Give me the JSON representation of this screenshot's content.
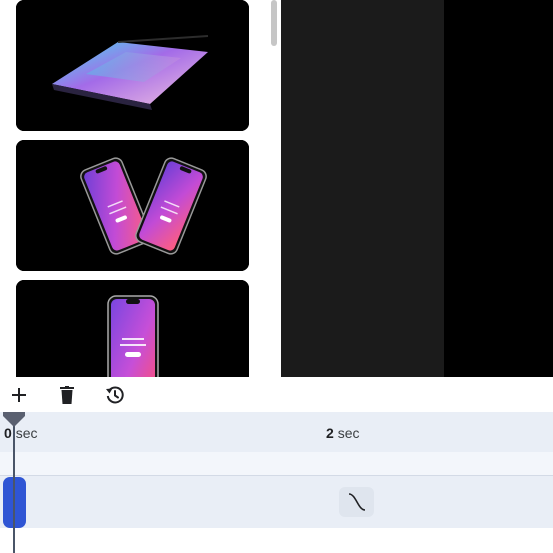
{
  "thumbnails": [
    {
      "name": "laptop-mockup"
    },
    {
      "name": "two-phones-mockup"
    },
    {
      "name": "single-phone-mockup"
    }
  ],
  "toolbar": {
    "add_icon": "plus-icon",
    "delete_icon": "trash-icon",
    "history_icon": "history-icon"
  },
  "timeline": {
    "ruler": [
      {
        "num": "0",
        "unit": "sec"
      },
      {
        "num": "2",
        "unit": "sec"
      }
    ],
    "transition_icon": "ease-curve-icon"
  },
  "colors": {
    "clip_accent": "#2f55d4",
    "ruler_bg": "#e9eef6",
    "preview_bg": "#1b1b1b"
  }
}
